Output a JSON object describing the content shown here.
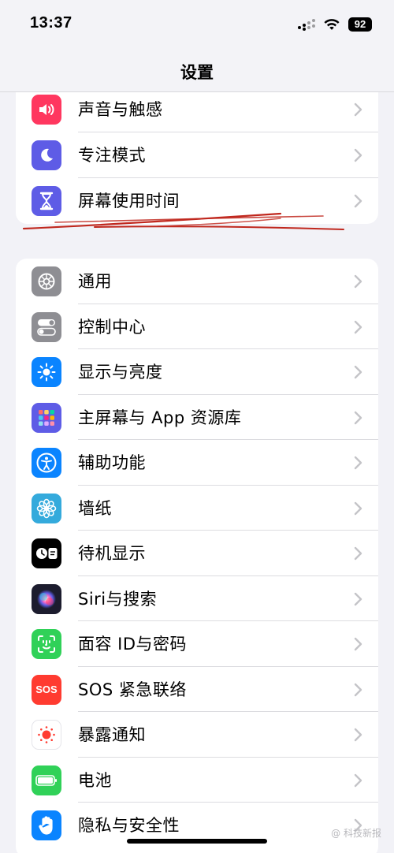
{
  "status": {
    "time": "13:37",
    "battery": "92"
  },
  "nav": {
    "title": "设置"
  },
  "top_group": [
    {
      "label": "声音与触感",
      "icon": "speaker-icon",
      "color": "#ff375f"
    },
    {
      "label": "专注模式",
      "icon": "moon-icon",
      "color": "#5e5ce6"
    },
    {
      "label": "屏幕使用时间",
      "icon": "hourglass-icon",
      "color": "#5e5ce6"
    }
  ],
  "main_group": [
    {
      "label": "通用",
      "icon": "gear-icon",
      "color": "#8e8e93"
    },
    {
      "label": "控制中心",
      "icon": "toggles-icon",
      "color": "#8e8e93"
    },
    {
      "label": "显示与亮度",
      "icon": "sun-icon",
      "color": "#0a84ff"
    },
    {
      "label": "主屏幕与 App 资源库",
      "icon": "app-grid-icon",
      "color": "#5e5ce6"
    },
    {
      "label": "辅助功能",
      "icon": "accessibility-icon",
      "color": "#0a84ff"
    },
    {
      "label": "墙纸",
      "icon": "flower-icon",
      "color": "#34aadc"
    },
    {
      "label": "待机显示",
      "icon": "standby-icon",
      "color": "#000000"
    },
    {
      "label": "Siri与搜索",
      "icon": "siri-icon",
      "color": "#1c1c2e"
    },
    {
      "label": "面容 ID与密码",
      "icon": "face-id-icon",
      "color": "#30d158"
    },
    {
      "label": "SOS 紧急联络",
      "icon": "sos-icon",
      "color": "#ff3b30",
      "icon_text": "SOS"
    },
    {
      "label": "暴露通知",
      "icon": "exposure-icon",
      "color": "#ffffff"
    },
    {
      "label": "电池",
      "icon": "battery-icon",
      "color": "#30d158"
    },
    {
      "label": "隐私与安全性",
      "icon": "hand-icon",
      "color": "#0a84ff"
    }
  ],
  "watermark": "@ 科技新报"
}
